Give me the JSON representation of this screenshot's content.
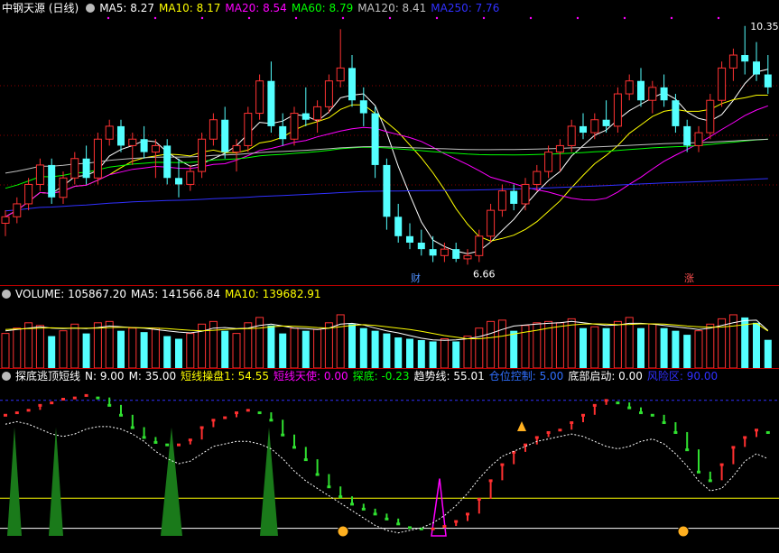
{
  "price_panel": {
    "title": "中钢天源 (日线)",
    "ma": [
      {
        "label": "MA5: 8.27",
        "color": "#ffffff"
      },
      {
        "label": "MA10: 8.17",
        "color": "#ffff00"
      },
      {
        "label": "MA20: 8.54",
        "color": "#ff00ff"
      },
      {
        "label": "MA60: 8.79",
        "color": "#00ff00"
      },
      {
        "label": "MA120: 8.41",
        "color": "#c0c0c0"
      },
      {
        "label": "MA250: 7.76",
        "color": "#3030ff"
      }
    ],
    "high_label": "10.35",
    "low_label": "6.66",
    "marker_cai": "财",
    "marker_zhang": "涨"
  },
  "volume_panel": {
    "label_vol": "VOLUME: 105867.20",
    "label_ma5": "MA5: 141566.84",
    "label_ma10": "MA10: 139682.91"
  },
  "indicator_panel": {
    "title": "探底逃顶短线",
    "items": [
      {
        "label": "N: 9.00",
        "color": "#ffffff"
      },
      {
        "label": "M: 35.00",
        "color": "#ffffff"
      },
      {
        "label": "短线操盘1: 54.55",
        "color": "#ffff00"
      },
      {
        "label": "短线天使: 0.00",
        "color": "#ff00ff"
      },
      {
        "label": "探底: -0.23",
        "color": "#00ff00"
      },
      {
        "label": "趋势线: 55.01",
        "color": "#ffffff"
      },
      {
        "label": "仓位控制: 5.00",
        "color": "#3070ff"
      },
      {
        "label": "底部启动: 0.00",
        "color": "#ffffff"
      },
      {
        "label": "风险区: 90.00",
        "color": "#3030ff"
      }
    ]
  },
  "chart_data": [
    {
      "type": "candlestick",
      "ohlc": [
        [
          7.3,
          7.5,
          7.1,
          7.4
        ],
        [
          7.4,
          7.7,
          7.3,
          7.6
        ],
        [
          7.6,
          8.0,
          7.5,
          7.9
        ],
        [
          7.9,
          8.3,
          7.8,
          8.2
        ],
        [
          8.2,
          8.3,
          7.6,
          7.7
        ],
        [
          7.7,
          8.1,
          7.6,
          8.0
        ],
        [
          8.0,
          8.4,
          7.9,
          8.3
        ],
        [
          8.3,
          8.5,
          7.9,
          8.0
        ],
        [
          8.0,
          8.7,
          7.9,
          8.6
        ],
        [
          8.6,
          8.9,
          8.5,
          8.8
        ],
        [
          8.8,
          8.9,
          8.4,
          8.5
        ],
        [
          8.5,
          8.7,
          8.2,
          8.6
        ],
        [
          8.6,
          8.8,
          8.3,
          8.4
        ],
        [
          8.4,
          8.6,
          8.0,
          8.5
        ],
        [
          8.5,
          8.6,
          7.9,
          8.0
        ],
        [
          8.0,
          8.3,
          7.7,
          7.9
        ],
        [
          7.9,
          8.2,
          7.8,
          8.1
        ],
        [
          8.1,
          8.7,
          8.0,
          8.6
        ],
        [
          8.6,
          9.0,
          8.5,
          8.9
        ],
        [
          8.9,
          9.1,
          8.3,
          8.4
        ],
        [
          8.4,
          8.6,
          8.1,
          8.5
        ],
        [
          8.5,
          9.1,
          8.4,
          9.0
        ],
        [
          9.0,
          9.6,
          8.9,
          9.5
        ],
        [
          9.5,
          9.8,
          8.7,
          8.8
        ],
        [
          8.8,
          9.0,
          8.5,
          8.6
        ],
        [
          8.6,
          9.1,
          8.5,
          9.0
        ],
        [
          9.0,
          9.4,
          8.8,
          8.9
        ],
        [
          8.9,
          9.2,
          8.7,
          9.1
        ],
        [
          9.1,
          9.6,
          9.0,
          9.5
        ],
        [
          9.5,
          10.3,
          9.4,
          9.7
        ],
        [
          9.7,
          9.9,
          9.1,
          9.2
        ],
        [
          9.2,
          9.4,
          8.8,
          9.0
        ],
        [
          9.0,
          9.1,
          8.0,
          8.2
        ],
        [
          8.2,
          8.3,
          7.2,
          7.4
        ],
        [
          7.4,
          7.6,
          7.0,
          7.1
        ],
        [
          7.1,
          7.3,
          6.9,
          7.0
        ],
        [
          7.0,
          7.2,
          6.8,
          6.9
        ],
        [
          6.9,
          7.1,
          6.7,
          6.8
        ],
        [
          6.8,
          7.0,
          6.7,
          6.9
        ],
        [
          6.9,
          7.0,
          6.7,
          6.75
        ],
        [
          6.75,
          6.9,
          6.66,
          6.8
        ],
        [
          6.8,
          7.2,
          6.7,
          7.1
        ],
        [
          7.1,
          7.6,
          7.0,
          7.5
        ],
        [
          7.5,
          7.9,
          7.4,
          7.8
        ],
        [
          7.8,
          7.9,
          7.5,
          7.6
        ],
        [
          7.6,
          8.0,
          7.5,
          7.9
        ],
        [
          7.9,
          8.2,
          7.8,
          8.1
        ],
        [
          8.1,
          8.5,
          8.0,
          8.4
        ],
        [
          8.4,
          8.6,
          8.1,
          8.5
        ],
        [
          8.5,
          8.9,
          8.4,
          8.8
        ],
        [
          8.8,
          9.0,
          8.6,
          8.7
        ],
        [
          8.7,
          9.0,
          8.6,
          8.9
        ],
        [
          8.9,
          9.2,
          8.7,
          8.8
        ],
        [
          8.8,
          9.4,
          8.7,
          9.3
        ],
        [
          9.3,
          9.6,
          9.2,
          9.5
        ],
        [
          9.5,
          9.7,
          9.1,
          9.2
        ],
        [
          9.2,
          9.5,
          9.0,
          9.4
        ],
        [
          9.4,
          9.6,
          9.1,
          9.2
        ],
        [
          9.2,
          9.3,
          8.7,
          8.8
        ],
        [
          8.8,
          8.9,
          8.4,
          8.5
        ],
        [
          8.5,
          8.8,
          8.4,
          8.7
        ],
        [
          8.7,
          9.3,
          8.6,
          9.2
        ],
        [
          9.2,
          9.8,
          9.1,
          9.7
        ],
        [
          9.7,
          10.0,
          9.5,
          9.9
        ],
        [
          9.9,
          10.35,
          9.6,
          9.8
        ],
        [
          9.8,
          10.1,
          9.5,
          9.6
        ],
        [
          9.6,
          9.9,
          9.3,
          9.4
        ]
      ],
      "ylim": [
        6.4,
        10.5
      ]
    },
    {
      "type": "bar",
      "series": [
        {
          "name": "VOLUME",
          "values": [
            130,
            150,
            170,
            160,
            120,
            140,
            165,
            130,
            170,
            175,
            140,
            150,
            135,
            150,
            120,
            110,
            130,
            165,
            175,
            140,
            130,
            170,
            190,
            160,
            130,
            150,
            140,
            145,
            170,
            200,
            165,
            150,
            140,
            130,
            115,
            110,
            105,
            100,
            110,
            100,
            120,
            150,
            175,
            180,
            140,
            160,
            170,
            175,
            170,
            185,
            150,
            155,
            150,
            175,
            190,
            150,
            165,
            150,
            140,
            125,
            140,
            165,
            185,
            200,
            190,
            170,
            106
          ]
        },
        {
          "name": "MA5",
          "values": [
            140,
            145,
            150,
            155,
            150,
            148,
            150,
            148,
            152,
            158,
            155,
            152,
            150,
            145,
            140,
            135,
            132,
            138,
            150,
            152,
            148,
            150,
            160,
            165,
            158,
            150,
            148,
            145,
            150,
            165,
            168,
            162,
            150,
            140,
            132,
            122,
            112,
            106,
            104,
            106,
            110,
            118,
            130,
            145,
            158,
            162,
            165,
            168,
            170,
            175,
            170,
            165,
            160,
            162,
            168,
            168,
            165,
            160,
            155,
            150,
            145,
            150,
            160,
            170,
            178,
            180,
            141
          ]
        },
        {
          "name": "MA10",
          "values": [
            145,
            147,
            148,
            150,
            151,
            150,
            150,
            150,
            150,
            152,
            153,
            152,
            151,
            150,
            148,
            145,
            142,
            140,
            142,
            145,
            147,
            148,
            150,
            155,
            158,
            157,
            155,
            152,
            150,
            155,
            160,
            163,
            160,
            155,
            150,
            145,
            138,
            130,
            122,
            116,
            110,
            110,
            114,
            120,
            128,
            135,
            142,
            150,
            156,
            162,
            165,
            166,
            165,
            163,
            164,
            166,
            166,
            165,
            162,
            158,
            155,
            153,
            154,
            158,
            163,
            168,
            139
          ]
        }
      ]
    }
  ]
}
